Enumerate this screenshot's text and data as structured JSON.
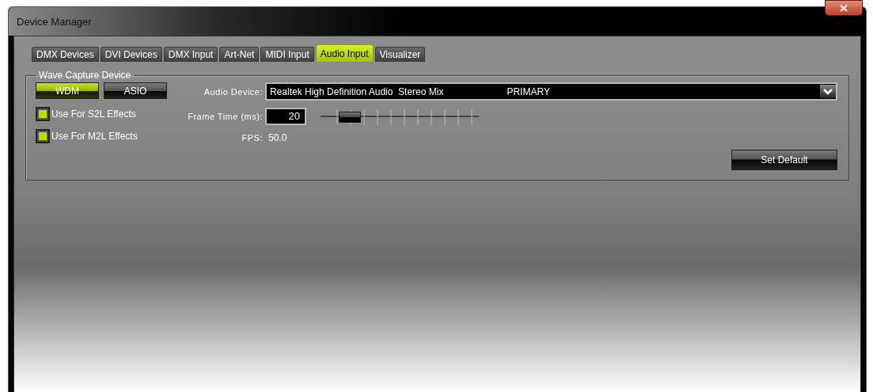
{
  "window": {
    "title": "Device Manager"
  },
  "tabs": [
    {
      "label": "DMX Devices",
      "selected": false
    },
    {
      "label": "DVI Devices",
      "selected": false
    },
    {
      "label": "DMX Input",
      "selected": false
    },
    {
      "label": "Art-Net",
      "selected": false
    },
    {
      "label": "MIDI Input",
      "selected": false
    },
    {
      "label": "Audio Input",
      "selected": true
    },
    {
      "label": "Visualizer",
      "selected": false
    }
  ],
  "group": {
    "title": "Wave Capture Device",
    "drivers": [
      {
        "label": "WDM",
        "selected": true
      },
      {
        "label": "ASIO",
        "selected": false
      }
    ],
    "checkboxes": [
      {
        "label": "Use For S2L Effects",
        "checked": true
      },
      {
        "label": "Use For M2L Effects",
        "checked": true
      }
    ],
    "audio_device": {
      "label": "Audio Device:",
      "value": "Realtek High Definition Audio  Stereo Mix",
      "value_2": "PRIMARY"
    },
    "frame_time": {
      "label": "Frame Time (ms):",
      "value": "20",
      "level": 0.13
    },
    "fps": {
      "label": "FPS:",
      "value": "50.0"
    },
    "set_default": "Set Default"
  }
}
